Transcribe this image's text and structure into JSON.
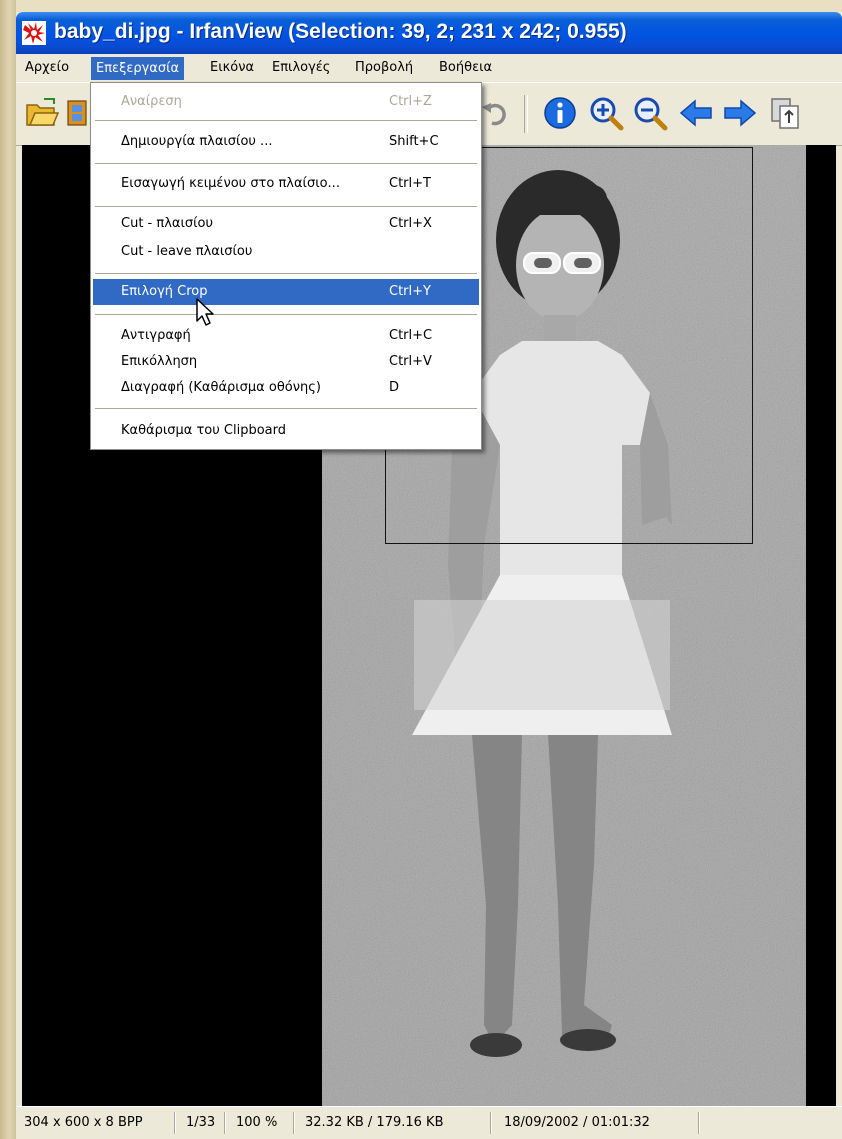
{
  "window": {
    "title": "baby_di.jpg - IrfanView (Selection: 39, 2; 231 x 242; 0.955)"
  },
  "menubar": {
    "items": [
      {
        "label": "Αρχείο"
      },
      {
        "label": "Επεξεργασία",
        "active": true
      },
      {
        "label": "Εικόνα"
      },
      {
        "label": "Επιλογές"
      },
      {
        "label": "Προβολή"
      },
      {
        "label": "Βοήθεια"
      }
    ]
  },
  "toolbar": {
    "buttons": [
      "open-folder-icon",
      "filmstrip-icon",
      "undo-icon",
      "info-icon",
      "zoom-in-icon",
      "zoom-out-icon",
      "previous-arrow-icon",
      "next-arrow-icon",
      "copy-icon"
    ]
  },
  "edit_menu": {
    "items": [
      {
        "label": "Αναίρεση",
        "shortcut": "Ctrl+Z",
        "disabled": true
      },
      {
        "label": "Δημιουργία πλαισίου ...",
        "shortcut": "Shift+C"
      },
      {
        "label": "Εισαγωγή κειμένου στο πλαίσιο...",
        "shortcut": "Ctrl+T"
      },
      {
        "label": "Cut - πλαισίου",
        "shortcut": "Ctrl+X"
      },
      {
        "label": "Cut - leave πλαισίου",
        "shortcut": ""
      },
      {
        "label": "Επιλογή Crop",
        "shortcut": "Ctrl+Y",
        "highlighted": true
      },
      {
        "label": "Αντιγραφή",
        "shortcut": "Ctrl+C"
      },
      {
        "label": "Επικόλληση",
        "shortcut": "Ctrl+V"
      },
      {
        "label": "Διαγραφή (Καθάρισμα οθόνης)",
        "shortcut": "D"
      },
      {
        "label": "Καθάρισμα του Clipboard",
        "shortcut": ""
      }
    ]
  },
  "statusbar": {
    "dimensions": "304 x 600 x 8 BPP",
    "index": "1/33",
    "zoom": "100 %",
    "filesize": "32.32 KB / 179.16 KB",
    "datetime": "18/09/2002 / 01:01:32"
  },
  "colors": {
    "titlebar": "#0054e3",
    "menu_highlight": "#316ac5",
    "viewport": "#000000"
  }
}
